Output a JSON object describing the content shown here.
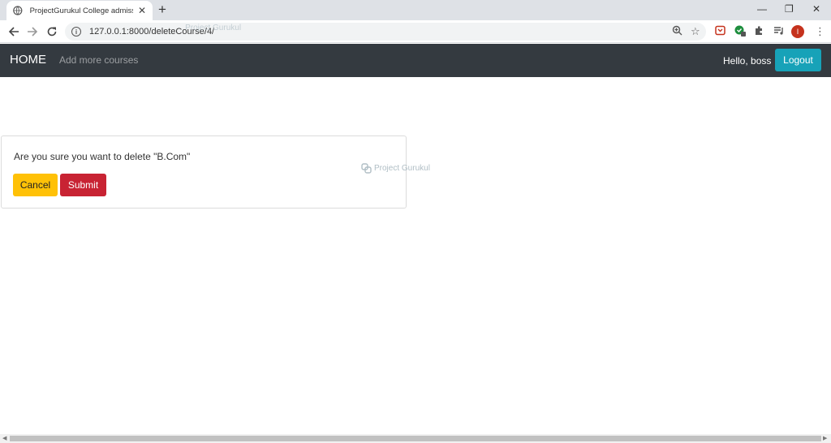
{
  "browser": {
    "tab_title": "ProjectGurukul College admission",
    "tab_close": "✕",
    "new_tab": "+",
    "url": "127.0.0.1:8000/deleteCourse/4/",
    "url_watermark": "Project Gurukul",
    "avatar_letter": "I",
    "minimize": "—",
    "restore": "❐",
    "close": "✕",
    "icons": [
      "back-icon",
      "forward-icon",
      "reload-icon",
      "info-icon",
      "zoom-icon",
      "star-icon",
      "extension-icon",
      "puzzle-icon",
      "media-icon",
      "menu-icon"
    ]
  },
  "navbar": {
    "brand": "HOME",
    "link_add_courses": "Add more courses",
    "greeting": "Hello, boss",
    "logout_label": "Logout"
  },
  "dialog": {
    "message": "Are you sure you want to delete \"B.Com\"",
    "cancel_label": "Cancel",
    "submit_label": "Submit"
  },
  "watermark": "Project Gurukul",
  "colors": {
    "navbar_bg": "#343a40",
    "logout_bg": "#17a2b8",
    "cancel_bg": "#ffc107",
    "submit_bg": "#c82333"
  }
}
